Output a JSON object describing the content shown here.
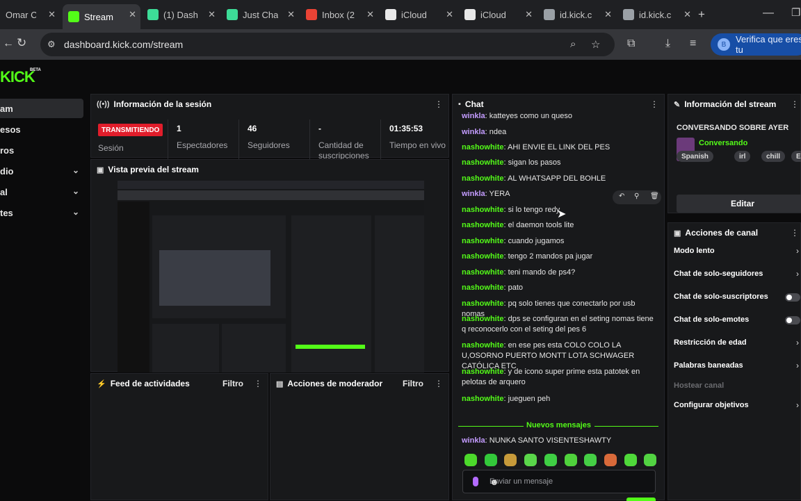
{
  "browser": {
    "tabs": [
      {
        "label": "Omar C",
        "favicon": "omar",
        "color": "#5f6368"
      },
      {
        "label": "Stream",
        "favicon": "kick",
        "color": "#53fc18"
      },
      {
        "label": "(1) Dash",
        "favicon": "kick-dash",
        "color": "#3ddc97"
      },
      {
        "label": "Just Cha",
        "favicon": "just-chatting",
        "color": "#3ddc97"
      },
      {
        "label": "Inbox (2",
        "favicon": "gmail",
        "color": "#ea4335"
      },
      {
        "label": "iCloud",
        "favicon": "apple",
        "color": "#e8e8e8"
      },
      {
        "label": "iCloud",
        "favicon": "apple",
        "color": "#e8e8e8"
      },
      {
        "label": "id.kick.c",
        "favicon": "globe",
        "color": "#9aa0a6"
      },
      {
        "label": "id.kick.c",
        "favicon": "globe",
        "color": "#9aa0a6"
      }
    ],
    "url": "dashboard.kick.com/stream",
    "verify_label": "Verifica que eres tu",
    "verify_badge": "B"
  },
  "sidebar": {
    "logo": "KICK",
    "beta": "BETA",
    "items": [
      {
        "label": "am",
        "selected": true,
        "expandable": false
      },
      {
        "label": "esos",
        "selected": false,
        "expandable": false
      },
      {
        "label": "ros",
        "selected": false,
        "expandable": false
      },
      {
        "label": "dio",
        "selected": false,
        "expandable": true
      },
      {
        "label": "al",
        "selected": false,
        "expandable": true
      },
      {
        "label": "tes",
        "selected": false,
        "expandable": true
      }
    ]
  },
  "session": {
    "title": "Información de la sesión",
    "live_badge": "TRANSMITIENDO",
    "live_label": "Sesión",
    "stats": [
      {
        "value": "1",
        "label": "Espectadores"
      },
      {
        "value": "46",
        "label": "Seguidores"
      },
      {
        "value": "-",
        "label": "Cantidad de suscripciones"
      },
      {
        "value": "01:35:53",
        "label": "Tiempo en vivo"
      }
    ]
  },
  "preview": {
    "title": "Vista previa del stream"
  },
  "activity": {
    "title": "Feed de actividades",
    "filter": "Filtro"
  },
  "moderator": {
    "title": "Acciones de moderador",
    "filter": "Filtro"
  },
  "chat": {
    "title": "Chat",
    "messages": [
      {
        "user": "winkla",
        "text": "katteyes como un queso"
      },
      {
        "user": "winkla",
        "text": "ndea"
      },
      {
        "user": "nashowhite",
        "text": "AHI ENVIE EL LINK DEL PES"
      },
      {
        "user": "nashowhite",
        "text": "sigan los pasos"
      },
      {
        "user": "nashowhite",
        "text": "AL WHATSAPP DEL BOHLE"
      },
      {
        "user": "winkla",
        "text": "YERA"
      },
      {
        "user": "nashowhite",
        "text": "si lo tengo redy"
      },
      {
        "user": "nashowhite",
        "text": "el daemon tools lite"
      },
      {
        "user": "nashowhite",
        "text": "cuando jugamos"
      },
      {
        "user": "nashowhite",
        "text": "tengo 2 mandos pa jugar"
      },
      {
        "user": "nashowhite",
        "text": "teni mando de ps4?"
      },
      {
        "user": "nashowhite",
        "text": "pato"
      },
      {
        "user": "nashowhite",
        "text": "pq solo tienes que conectarlo por usb nomas"
      },
      {
        "user": "nashowhite",
        "text": "dps se configuran en el seting nomas tiene q reconocerlo con el seting del pes 6"
      },
      {
        "user": "nashowhite",
        "text": "en ese pes esta COLO COLO LA U,OSORNO PUERTO MONTT LOTA SCHWAGER CATÓLICA ETC"
      },
      {
        "user": "nashowhite",
        "text": "y de icono super prime esta patotek en pelotas de arquero"
      },
      {
        "user": "nashowhite",
        "text": "jueguen peh"
      }
    ],
    "new_messages_label": "Nuevos mensajes",
    "after_new": {
      "user": "winkla",
      "text": "NUNKA SANTO VISENTESHAWTY"
    },
    "input_placeholder": "Enviar un mensaje"
  },
  "stream_info": {
    "title": "Información del stream",
    "stream_title": "CONVERSANDO SOBRE AYER",
    "category": "Conversando",
    "tags": [
      "Spanish",
      "irl",
      "chill",
      "Españ"
    ],
    "edit_label": "Editar"
  },
  "channel_actions": {
    "title": "Acciones de canal",
    "items": [
      {
        "label": "Modo lento",
        "control": "arrow",
        "disabled": false
      },
      {
        "label": "Chat de solo-seguidores",
        "control": "arrow",
        "disabled": false
      },
      {
        "label": "Chat de solo-suscriptores",
        "control": "toggle",
        "disabled": false
      },
      {
        "label": "Chat de solo-emotes",
        "control": "toggle",
        "disabled": false
      },
      {
        "label": "Restricción de edad",
        "control": "arrow",
        "disabled": false
      },
      {
        "label": "Palabras baneadas",
        "control": "arrow",
        "disabled": false
      },
      {
        "label": "Hostear canal",
        "control": "none",
        "disabled": true
      },
      {
        "label": "Configurar objetivos",
        "control": "arrow",
        "disabled": false
      }
    ]
  }
}
